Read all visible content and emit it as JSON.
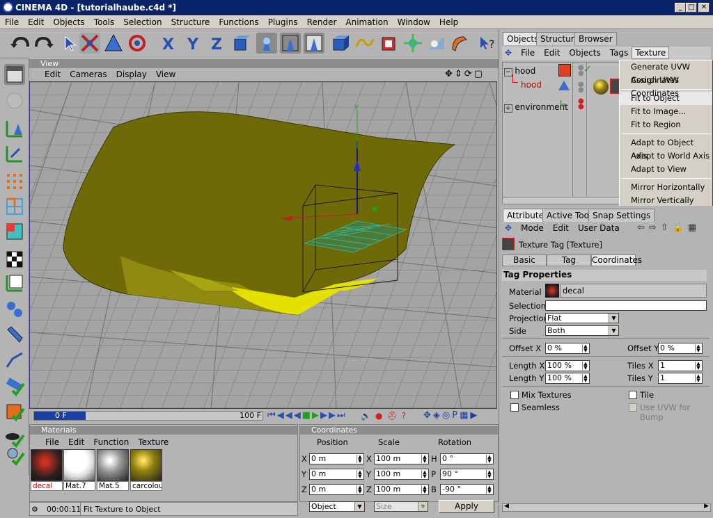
{
  "window": {
    "title": "CINEMA 4D - [tutorialhaube.c4d *]",
    "btn_min": "_",
    "btn_max": "□",
    "btn_close": "✕"
  },
  "menubar": [
    "File",
    "Edit",
    "Objects",
    "Tools",
    "Selection",
    "Structure",
    "Functions",
    "Plugins",
    "Render",
    "Animation",
    "Window",
    "Help"
  ],
  "viewport": {
    "title": "View",
    "menu": [
      "Edit",
      "Cameras",
      "Display",
      "View"
    ],
    "axis_label": "Y"
  },
  "timeline": {
    "current": "0 F",
    "end": "100 F"
  },
  "objects_panel": {
    "tabs": [
      "Objects",
      "Structure",
      "Browser"
    ],
    "menu": [
      "File",
      "Edit",
      "Objects",
      "Tags",
      "Texture"
    ],
    "items": [
      {
        "name": "hood",
        "expand": "−"
      },
      {
        "name": "hood"
      },
      {
        "name": "environment",
        "expand": "+"
      }
    ]
  },
  "texture_menu": {
    "group1": [
      "Generate UVW Coordinates",
      "Assign UVW Coordinates"
    ],
    "group2": [
      "Fit to Object",
      "Fit to Image...",
      "Fit to Region"
    ],
    "group3": [
      "Adapt to Object Axis",
      "Adapt to World Axis",
      "Adapt to View"
    ],
    "group4": [
      "Mirror Horizontally",
      "Mirror Vertically"
    ]
  },
  "attributes": {
    "tabs": [
      "Attributes",
      "Active Tool",
      "Snap Settings"
    ],
    "menu": [
      "Mode",
      "Edit",
      "User Data"
    ],
    "header": "Texture Tag [Texture]",
    "subtabs": [
      "Basic",
      "Tag",
      "Coordinates"
    ],
    "section": "Tag Properties",
    "material_label": "Material",
    "material_value": "decal",
    "selection_label": "Selection",
    "selection_value": "",
    "projection_label": "Projection",
    "projection_value": "Flat",
    "side_label": "Side",
    "side_value": "Both",
    "offsetx_label": "Offset X",
    "offsetx_value": "0 %",
    "offsety_label": "Offset Y",
    "offsety_value": "0 %",
    "lengthx_label": "Length X",
    "lengthx_value": "100 %",
    "lengthy_label": "Length Y",
    "lengthy_value": "100 %",
    "tilesx_label": "Tiles X",
    "tilesx_value": "1",
    "tilesy_label": "Tiles Y",
    "tilesy_value": "1",
    "mix_label": "Mix Textures",
    "tile_label": "Tile",
    "seamless_label": "Seamless",
    "useuvw_label": "Use UVW for Bump"
  },
  "materials": {
    "title": "Materials",
    "menu": [
      "File",
      "Edit",
      "Function",
      "Texture"
    ],
    "items": [
      "decal",
      "Mat.7",
      "Mat.5",
      "carcolou"
    ]
  },
  "coordinates": {
    "title": "Coordinates",
    "headers": [
      "Position",
      "Scale",
      "Rotation"
    ],
    "rows": [
      {
        "a": "X",
        "pos": "0 m",
        "b": "X",
        "scale": "100 m",
        "c": "H",
        "rot": "0 °"
      },
      {
        "a": "Y",
        "pos": "0 m",
        "b": "Y",
        "scale": "100 m",
        "c": "P",
        "rot": "90 °"
      },
      {
        "a": "Z",
        "pos": "0 m",
        "b": "Z",
        "scale": "100 m",
        "c": "B",
        "rot": "-90 °"
      }
    ],
    "mode": "Object",
    "size_mode": "Size",
    "apply": "Apply"
  },
  "statusbar": {
    "time": "00:00:11",
    "message": "Fit Texture to Object"
  },
  "colors": {
    "titlebar": "#0a246a",
    "hood": "#6e6a08",
    "hood_bright": "#e4e000",
    "grid": "#6f6f6f"
  }
}
